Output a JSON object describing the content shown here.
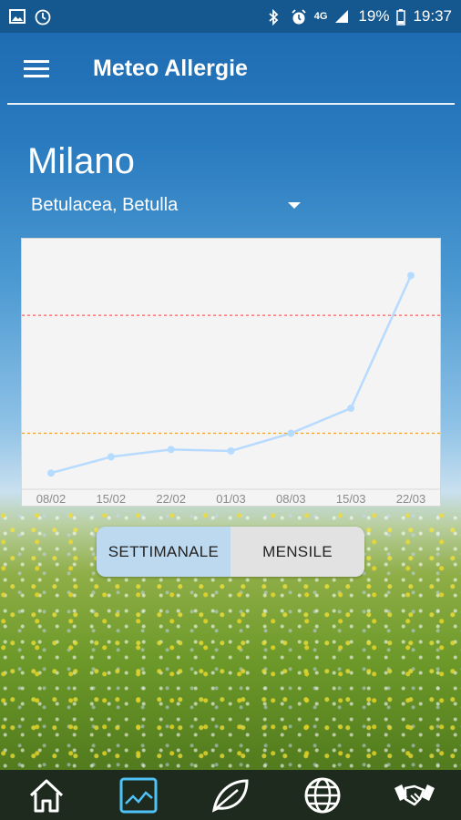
{
  "statusbar": {
    "battery": "19%",
    "time": "19:37",
    "network": "4G",
    "icons": [
      "image-icon",
      "clock-icon",
      "bluetooth-icon",
      "alarm-icon",
      "signal-icon",
      "battery-icon"
    ]
  },
  "appbar": {
    "title": "Meteo Allergie",
    "menu_icon": "hamburger-menu-icon"
  },
  "location": {
    "city": "Milano",
    "species": "Betulacea, Betulla"
  },
  "chart_data": {
    "type": "line",
    "categories": [
      "08/02",
      "15/02",
      "22/02",
      "01/03",
      "08/03",
      "15/03",
      "22/03"
    ],
    "series": [
      {
        "values": [
          0.1,
          1.2,
          1.7,
          1.6,
          2.8,
          4.5,
          13.5
        ]
      }
    ],
    "thresholds": [
      {
        "value": 2.8,
        "color": "#f0a020"
      },
      {
        "value": 10.8,
        "color": "#f06060"
      }
    ],
    "ylim": [
      -1,
      16
    ],
    "grid": false,
    "line_color": "#b7dbff"
  },
  "toggle": {
    "weekly_label": "SETTIMANALE",
    "monthly_label": "MENSILE",
    "selected": "weekly"
  },
  "bottom_nav": {
    "items": [
      "home-icon",
      "chart-icon",
      "leaf-icon",
      "globe-icon",
      "handshake-icon"
    ],
    "active": "chart-icon",
    "active_color": "#4fc3f7"
  }
}
